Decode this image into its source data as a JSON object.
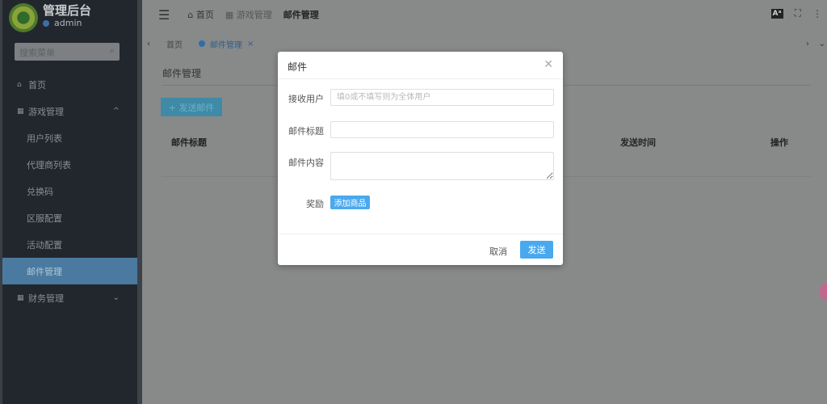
{
  "app": {
    "title": "管理后台",
    "user": "admin"
  },
  "sidebar": {
    "search_placeholder": "搜索菜单",
    "items": [
      {
        "label": "首页",
        "icon": "home-icon"
      },
      {
        "label": "游戏管理",
        "icon": "grid-icon",
        "expanded": true,
        "children": [
          "用户列表",
          "代理商列表",
          "兑换码",
          "区服配置",
          "活动配置",
          "邮件管理"
        ]
      },
      {
        "label": "财务管理",
        "icon": "grid-icon",
        "expanded": false
      }
    ],
    "active": "邮件管理"
  },
  "header": {
    "breadcrumb": [
      "首页",
      "游戏管理",
      "邮件管理"
    ]
  },
  "tags": [
    {
      "label": "首页"
    },
    {
      "label": "邮件管理",
      "active": true
    }
  ],
  "page": {
    "title": "邮件管理",
    "add_button": "+ 发送邮件",
    "columns": [
      "邮件标题",
      "发送时间",
      "操作"
    ]
  },
  "modal": {
    "title": "邮件",
    "fields": {
      "receiver": {
        "label": "接收用户",
        "value": "",
        "placeholder": "填0或不填写则为全体用户"
      },
      "subject": {
        "label": "邮件标题",
        "value": ""
      },
      "content": {
        "label": "邮件内容",
        "value": ""
      },
      "reward": {
        "label": "奖励",
        "button": "添加商品"
      }
    },
    "cancel": "取消",
    "send": "发送"
  },
  "colors": {
    "primary": "#409eff",
    "sidebar": "#304156"
  }
}
